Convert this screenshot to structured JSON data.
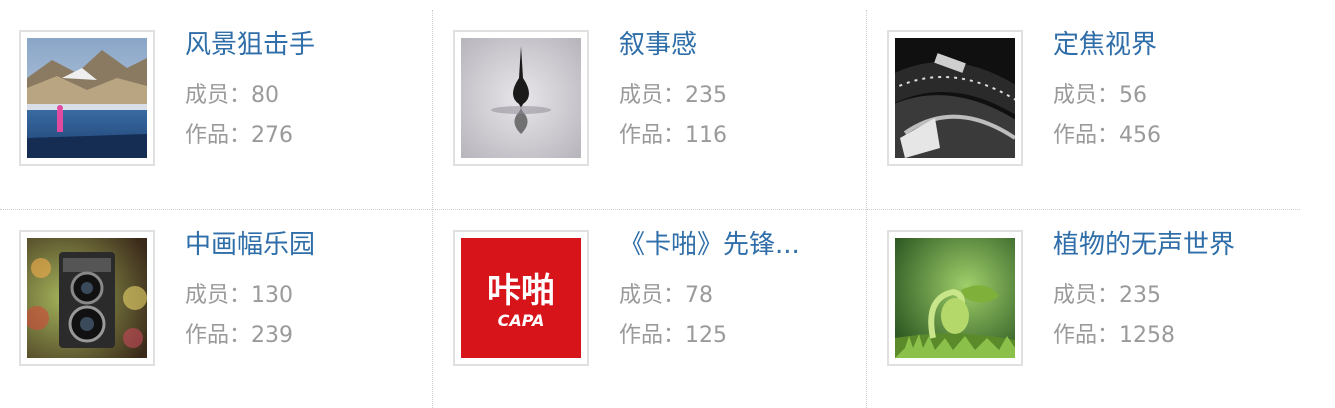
{
  "groups": [
    {
      "name": "风景狙击手",
      "members_label": "成员：",
      "members": "80",
      "works_label": "作品：",
      "works": "276",
      "thumb_icon": "landscape-photo"
    },
    {
      "name": "叙事感",
      "members_label": "成员：",
      "members": "235",
      "works_label": "作品：",
      "works": "116",
      "thumb_icon": "spinning-top-photo"
    },
    {
      "name": "定焦视界",
      "members_label": "成员：",
      "members": "56",
      "works_label": "作品：",
      "works": "456",
      "thumb_icon": "camera-lens-photo"
    },
    {
      "name": "中画幅乐园",
      "members_label": "成员：",
      "members": "130",
      "works_label": "作品：",
      "works": "239",
      "thumb_icon": "twin-lens-camera-photo"
    },
    {
      "name": "《卡啪》先锋...",
      "members_label": "成员：",
      "members": "78",
      "works_label": "作品：",
      "works": "125",
      "thumb_icon": "capa-logo",
      "thumb_text_cn": "咔啪",
      "thumb_text_en": "CAPA"
    },
    {
      "name": "植物的无声世界",
      "members_label": "成员：",
      "members": "235",
      "works_label": "作品：",
      "works": "1258",
      "thumb_icon": "sprout-photo"
    }
  ],
  "colors": {
    "title": "#2f6ea8",
    "meta": "#9a9a9a",
    "capa_red": "#d7141a"
  }
}
